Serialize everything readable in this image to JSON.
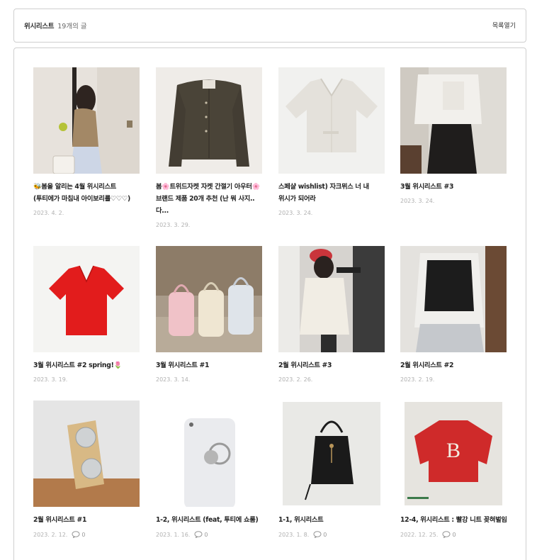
{
  "header": {
    "title": "위시리스트",
    "count": "19개의 글",
    "toggle_label": "목록열기"
  },
  "posts": [
    {
      "title": "🐝봄을 알리는 4월 위시리스트 (투티에가 마침내 아이보리를♡♡♡)",
      "date": "2023. 4. 2.",
      "comments": null,
      "thumb": "woman-beige-cardigan"
    },
    {
      "title": "봄🌸트위드자켓 자켓 간절기 아우터🌸 브랜드 제품 20개 추천 (난 뭐 사지.. 다...",
      "date": "2023. 3. 29.",
      "comments": null,
      "thumb": "tweed-jacket"
    },
    {
      "title": "스페샬 wishlist) 자크뮈스 너 내 위시가 되어라",
      "date": "2023. 3. 24.",
      "comments": null,
      "thumb": "cream-cardigan"
    },
    {
      "title": "3월 위시리스트 #3",
      "date": "2023. 3. 24.",
      "comments": null,
      "thumb": "white-jacket-skirt"
    },
    {
      "title": "3월 위시리스트 #2 spring!🌷",
      "date": "2023. 3. 19.",
      "comments": null,
      "thumb": "red-knit"
    },
    {
      "title": "3월 위시리스트 #1",
      "date": "2023. 3. 14.",
      "comments": null,
      "thumb": "mini-backpacks"
    },
    {
      "title": "2월 위시리스트 #3",
      "date": "2023. 2. 26.",
      "comments": null,
      "thumb": "ivory-jacket"
    },
    {
      "title": "2월 위시리스트 #2",
      "date": "2023. 2. 19.",
      "comments": null,
      "thumb": "knit-vest"
    },
    {
      "title": "2월 위시리스트 #1",
      "date": "2023. 2. 12.",
      "comments": "0",
      "thumb": "mirror"
    },
    {
      "title": "1-2, 위시리스트 (feat, 투티에 쇼룸)",
      "date": "2023. 1. 16.",
      "comments": "0",
      "thumb": "phone-case"
    },
    {
      "title": "1-1, 위시리스트",
      "date": "2023. 1. 8.",
      "comments": "0",
      "thumb": "black-backpack"
    },
    {
      "title": "12-4, 위시리스트 : 빨강 니트 꽂혀벌임",
      "date": "2022. 12. 25.",
      "comments": "0",
      "thumb": "red-sweater-b"
    }
  ],
  "icons": {
    "comment": "speech-bubble-icon"
  }
}
